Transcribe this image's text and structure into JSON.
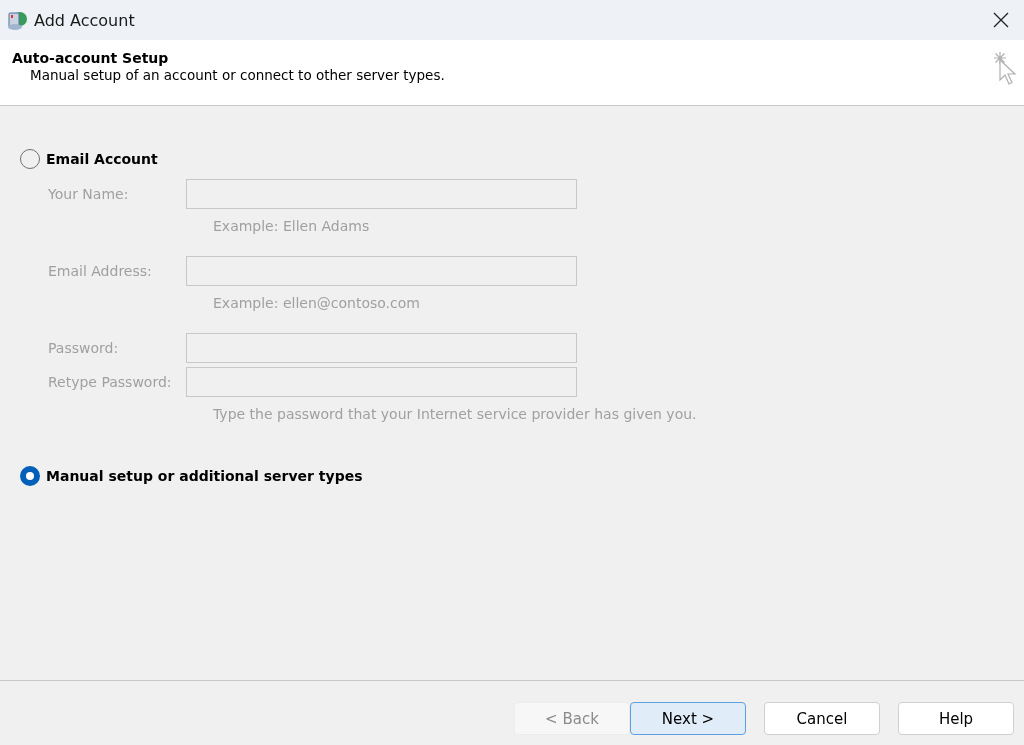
{
  "window": {
    "title": "Add Account"
  },
  "header": {
    "title": "Auto-account Setup",
    "subtitle": "Manual setup of an account or connect to other server types."
  },
  "options": [
    {
      "label": "Email Account",
      "selected": false,
      "fields": [
        {
          "label": "Your Name:",
          "disabled": true,
          "hint": "Example: Ellen Adams"
        },
        {
          "label": "Email Address:",
          "disabled": true,
          "hint": "Example: ellen@contoso.com"
        },
        {
          "label": "Password:",
          "disabled": true
        },
        {
          "label": "Retype Password:",
          "disabled": true,
          "hint": "Type the password that your Internet service provider has given you."
        }
      ]
    },
    {
      "label": "Manual setup or additional server types",
      "selected": true
    }
  ],
  "buttons": [
    {
      "label": "< Back",
      "disabled": true,
      "default": false
    },
    {
      "label": "Next >",
      "disabled": false,
      "default": true
    },
    {
      "label": "Cancel",
      "disabled": false,
      "default": false
    },
    {
      "label": "Help",
      "disabled": false,
      "default": false
    }
  ]
}
